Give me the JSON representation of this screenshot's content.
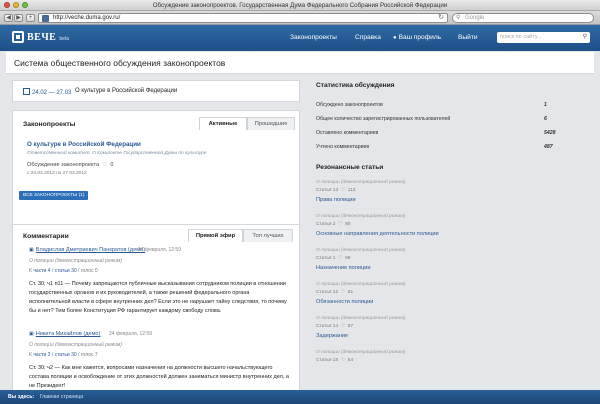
{
  "browser": {
    "window_title": "Обсуждение законопроектов. Государственная Дума Федерального Собрания Российской Федерации",
    "address": "http://veche.duma.gov.ru/",
    "search_placeholder": "Google"
  },
  "site": {
    "logo_text": "ВЕЧЕ",
    "logo_beta": "beta",
    "nav": [
      "Законопроекты",
      "Справка",
      "Ваш профиль",
      "Выйти"
    ],
    "search_placeholder": "поиск по сайту...",
    "page_title": "Система общественного обсуждения законопроектов"
  },
  "date_block": {
    "range": "24.02 — 27.03",
    "law": "О культуре в Российской Федерации"
  },
  "bills": {
    "heading": "Законопроекты",
    "tabs": [
      "Активные",
      "Прошедшие"
    ],
    "title": "О культуре в Российской Федерации",
    "subtitle": "Ответственный комитет: О Комитете Государственной Думы по культуре",
    "status": "Обсуждение законопроекта",
    "status_count": "0",
    "dates": "с 24.02.2012 по 27.03.2012",
    "all_button": "ВСЕ ЗАКОНОПРОЕКТЫ (1)"
  },
  "comments": {
    "heading": "Комментарии",
    "tabs": [
      "Прямой эфир",
      "Топ лучших"
    ],
    "items": [
      {
        "author": "Владислав Дмитриевич Панкратов (демо)",
        "date": "24 февраля, 12:59",
        "law": "О полиции (демонстрационный режим)",
        "meta_prefix": "К",
        "part": "части 4",
        "article": "статьи 30",
        "votes": "голос 0",
        "text": "Ст. 30; ч1 п11 — Почему запрещаются публичные высказывания сотрудником полиции в отношении государственных органов и их руководителей, а также решений федерального органа исполнительной власти в сфере внутренних дел? Если это не нарушает тайну следствия, то почему бы и нет? Тем более Конституция РФ гарантирует каждому свободу слова."
      },
      {
        "author": "Никита Михайлов (демо)",
        "date": "24 февраля, 12:59",
        "law": "О полиции (демонстрационный режим)",
        "meta_prefix": "К",
        "part": "части 3",
        "article": "статьи 30",
        "votes": "голос 7",
        "text": "Ст. 30; ч2 — Как мне кажется, вопросами назначения на должности высшего начальствующего состава полиции и освобождение от этих должностей должен заниматься министр внутренних дел, а не Президент!"
      }
    ]
  },
  "stats": {
    "heading": "Статистика обсуждения",
    "rows": [
      {
        "label": "Обсуждено законопроектов",
        "value": "1"
      },
      {
        "label": "Общее количество зарегистрированных пользователей",
        "value": "6"
      },
      {
        "label": "Оставлено комментариев",
        "value": "5428"
      },
      {
        "label": "Учтено комментариев",
        "value": "487"
      }
    ]
  },
  "articles": {
    "heading": "Резонансные статьи",
    "items": [
      {
        "hint": "О полиции (демонстрационный режим)",
        "label": "Статья 13",
        "count": "113",
        "title": "Права полиции"
      },
      {
        "hint": "О полиции (демонстрационный режим)",
        "label": "Статья 2",
        "count": "80",
        "title": "Основные направления деятельности полиции"
      },
      {
        "hint": "О полиции (демонстрационный режим)",
        "label": "Статья 1",
        "count": "69",
        "title": "Назначение полиции"
      },
      {
        "hint": "О полиции (демонстрационный режим)",
        "label": "Статья 12",
        "count": "61",
        "title": "Обязанности полиции"
      },
      {
        "hint": "О полиции (демонстрационный режим)",
        "label": "Статья 14",
        "count": "57",
        "title": "Задержание"
      },
      {
        "hint": "О полиции (демонстрационный режим)",
        "label": "Статья 15",
        "count": "54",
        "title": ""
      }
    ]
  },
  "bottom": {
    "label": "Вы здесь:",
    "home": "Главная страница"
  }
}
